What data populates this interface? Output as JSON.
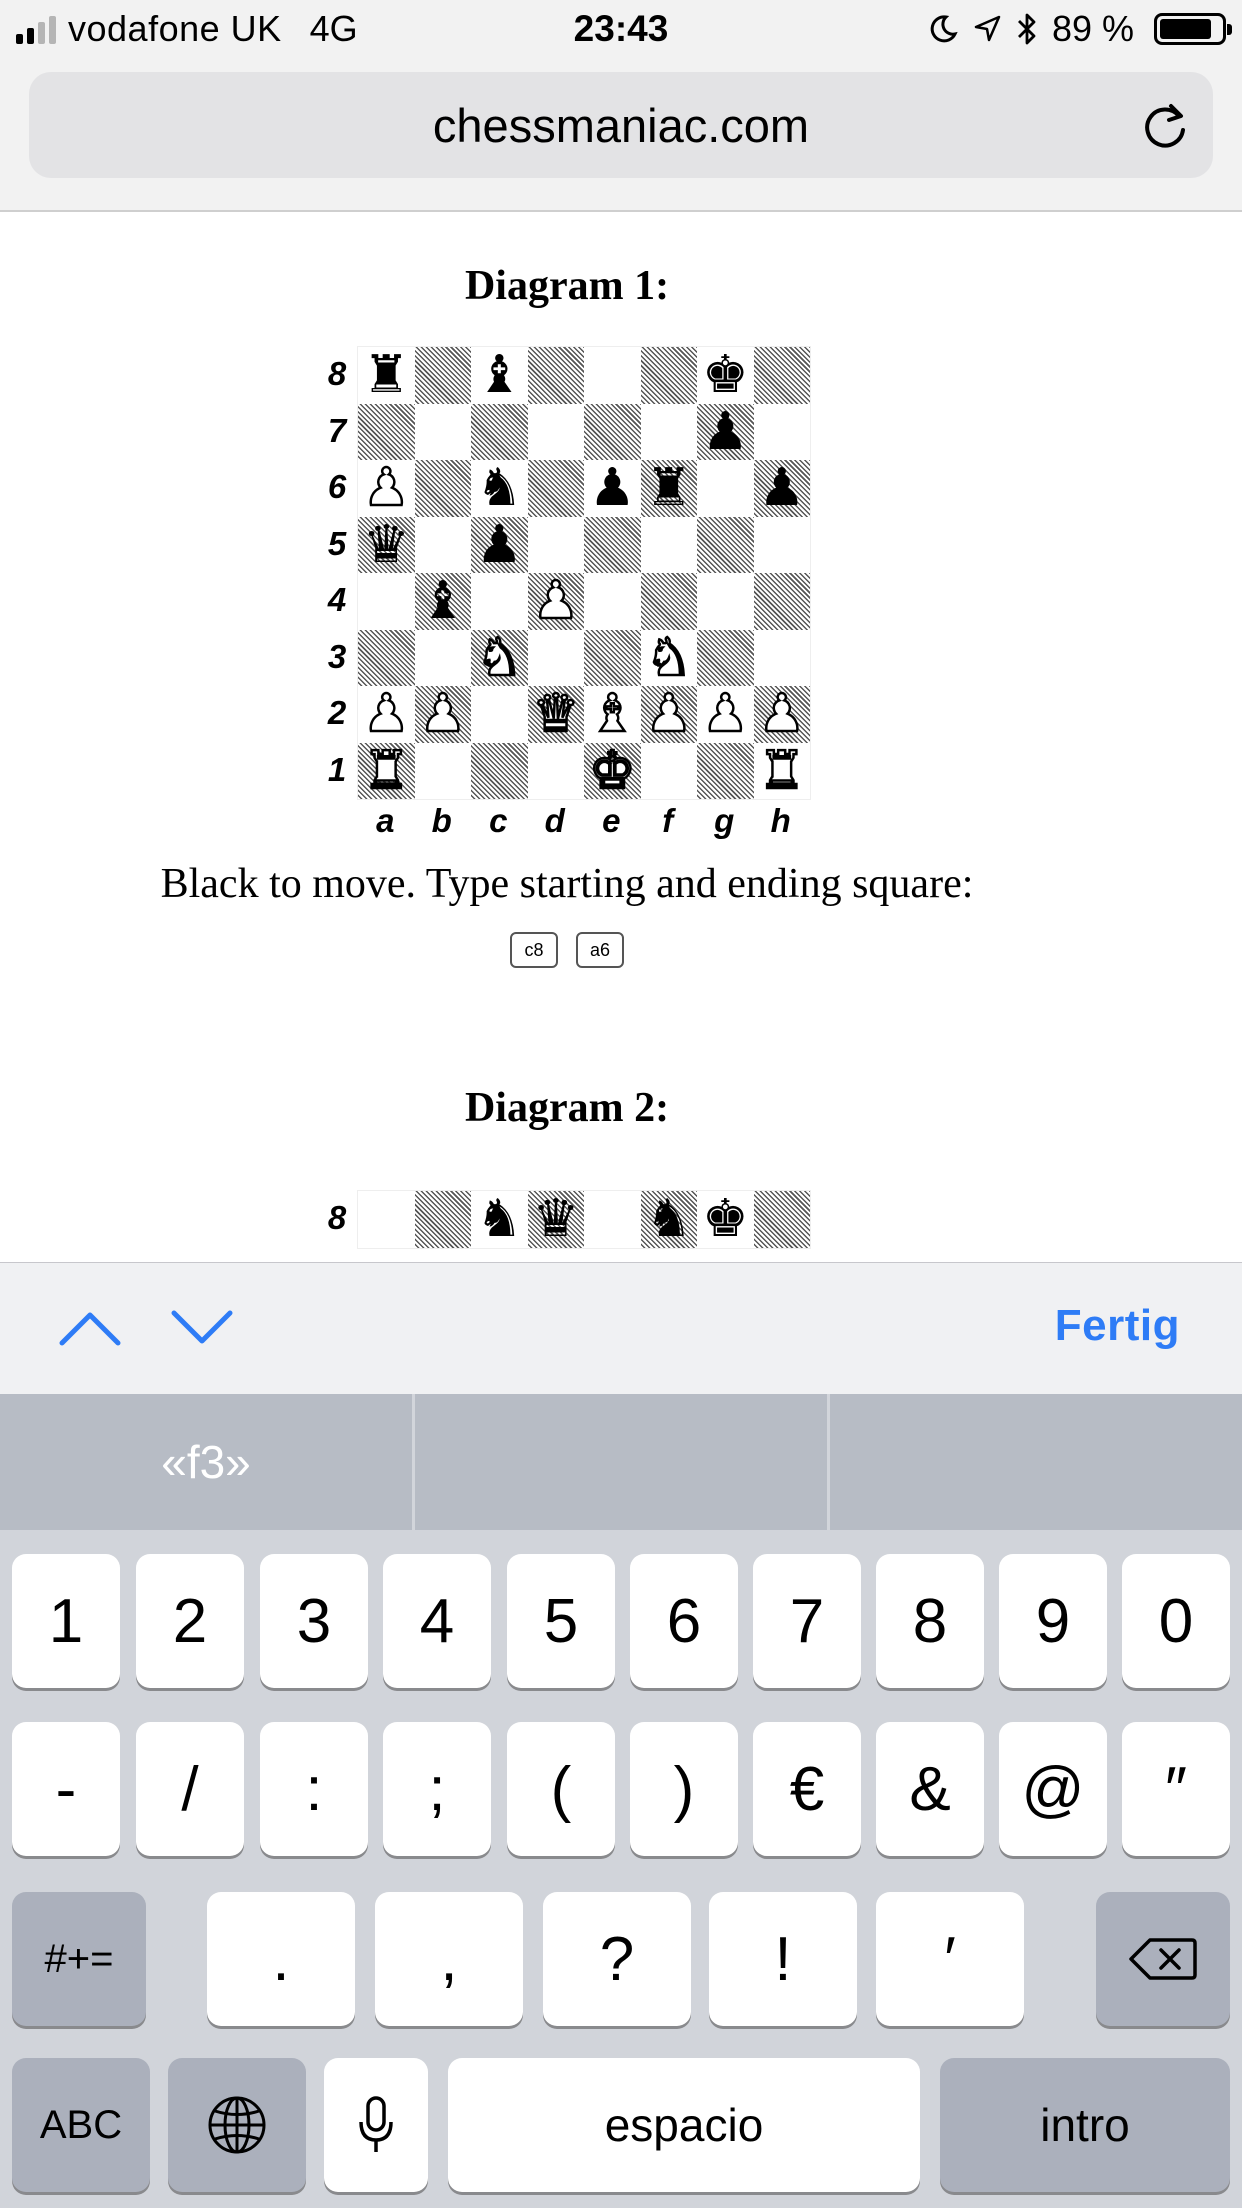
{
  "status_bar": {
    "carrier": "vodafone UK",
    "network": "4G",
    "time": "23:43",
    "battery": "89 %",
    "battery_level": 0.89,
    "icons": [
      "signal-bars-icon",
      "moon-icon",
      "location-arrow-icon",
      "bluetooth-icon",
      "battery-icon"
    ]
  },
  "browser": {
    "url": "chessmaniac.com",
    "reload_icon": "reload-icon"
  },
  "page": {
    "diagram1": {
      "title": "Diagram 1:",
      "instruction": "Black to move. Type starting and ending square:",
      "move_from": "c8",
      "move_to": "a6",
      "ranks": [
        "8",
        "7",
        "6",
        "5",
        "4",
        "3",
        "2",
        "1"
      ],
      "files": [
        "a",
        "b",
        "c",
        "d",
        "e",
        "f",
        "g",
        "h"
      ],
      "position": [
        [
          "r",
          "",
          "b",
          "",
          "",
          "",
          "k",
          ""
        ],
        [
          "",
          "",
          "",
          "",
          "",
          "",
          "p",
          ""
        ],
        [
          "P",
          "",
          "n",
          "",
          "p",
          "r",
          "",
          "p"
        ],
        [
          "q",
          "",
          "p",
          "",
          "",
          "",
          "",
          ""
        ],
        [
          "",
          "b",
          "",
          "P",
          "",
          "",
          "",
          ""
        ],
        [
          "",
          "",
          "N",
          "",
          "",
          "N",
          "",
          ""
        ],
        [
          "P",
          "P",
          "",
          "Q",
          "B",
          "P",
          "P",
          "P"
        ],
        [
          "R",
          "",
          "",
          "",
          "K",
          "",
          "",
          "R"
        ]
      ]
    },
    "diagram2": {
      "title": "Diagram 2:",
      "rank_label": "8",
      "rank8": [
        "",
        "",
        "n",
        "q",
        "",
        "n",
        "k",
        ""
      ]
    }
  },
  "accessory_bar": {
    "prev_icon": "chevron-up-icon",
    "next_icon": "chevron-down-icon",
    "done_label": "Fertig"
  },
  "suggestions": [
    "«f3»",
    "",
    ""
  ],
  "keyboard": {
    "row1": [
      "1",
      "2",
      "3",
      "4",
      "5",
      "6",
      "7",
      "8",
      "9",
      "0"
    ],
    "row2": [
      "-",
      "/",
      ":",
      ";",
      "(",
      ")",
      "€",
      "&",
      "@",
      "″"
    ],
    "row3_mode": "#+=",
    "row3": [
      ".",
      ",",
      "?",
      "!",
      "′"
    ],
    "delete_icon": "backspace-icon",
    "abc": "ABC",
    "globe_icon": "globe-icon",
    "mic_icon": "microphone-icon",
    "space": "espacio",
    "return": "intro"
  }
}
